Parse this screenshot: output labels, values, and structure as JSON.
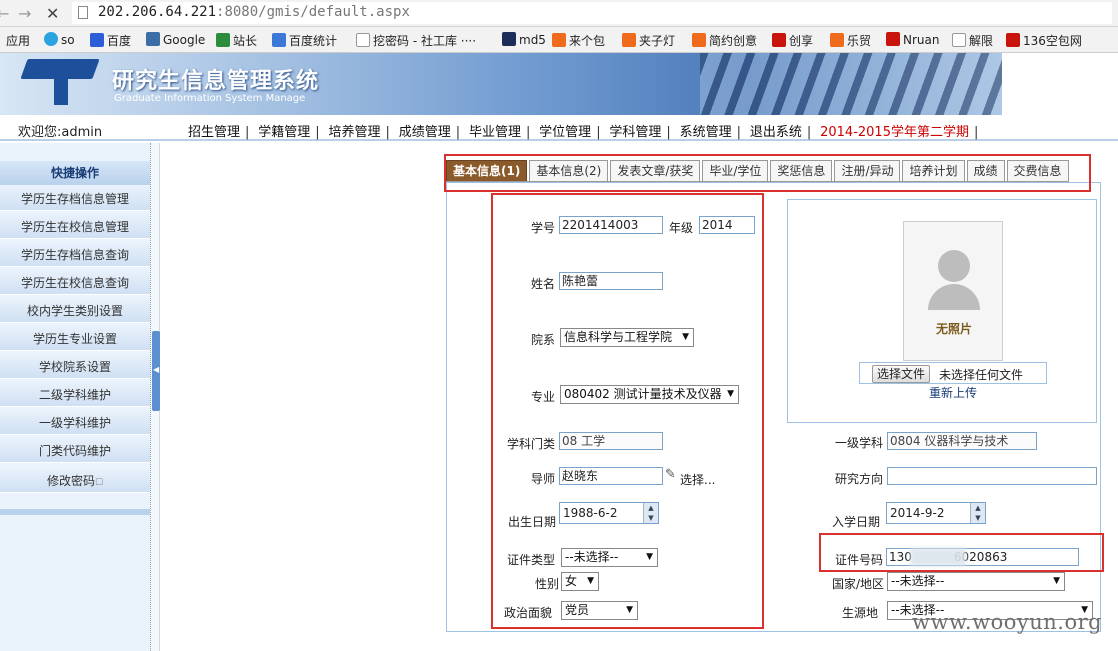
{
  "browser": {
    "url_host": "202.206.64.221",
    "url_rest": ":8080/gmis/default.aspx",
    "bookmarks": [
      "应用",
      "so",
      "百度",
      "Google",
      "站长",
      "百度统计",
      "挖密码 - 社工库 ····",
      "md5",
      "来个包",
      "夹子灯",
      "简约创意",
      "创享",
      "乐贸",
      "Nruan",
      "解限",
      "136空包网"
    ]
  },
  "header": {
    "title": "研究生信息管理系统",
    "subtitle": "Graduate Information System Manage"
  },
  "nav": {
    "welcome": "欢迎您:admin",
    "items": [
      "招生管理",
      "学籍管理",
      "培养管理",
      "成绩管理",
      "毕业管理",
      "学位管理",
      "学科管理",
      "系统管理",
      "退出系统"
    ],
    "term": "2014-2015学年第二学期"
  },
  "sidebar": {
    "header": "快捷操作",
    "items": [
      "学历生存档信息管理",
      "学历生在校信息管理",
      "学历生存档信息查询",
      "学历生在校信息查询",
      "校内学生类别设置",
      "学历生专业设置",
      "学校院系设置",
      "二级学科维护",
      "一级学科维护",
      "门类代码维护"
    ],
    "change_password": "修改密码"
  },
  "tabs": [
    "基本信息(1)",
    "基本信息(2)",
    "发表文章/获奖",
    "毕业/学位",
    "奖惩信息",
    "注册/异动",
    "培养计划",
    "成绩",
    "交费信息"
  ],
  "form": {
    "student_id_label": "学号",
    "student_id": "2201414003",
    "grade_label": "年级",
    "grade": "2014",
    "name_label": "姓名",
    "name": "陈艳蕾",
    "department_label": "院系",
    "department": "信息科学与工程学院",
    "major_label": "专业",
    "major": "080402 测试计量技术及仪器",
    "discipline_category_label": "学科门类",
    "discipline_category": "08 工学",
    "primary_discipline_label": "一级学科",
    "primary_discipline": "0804 仪器科学与技术",
    "advisor_label": "导师",
    "advisor": "赵晓东",
    "advisor_select": "选择...",
    "research_direction_label": "研究方向",
    "research_direction": "",
    "birth_date_label": "出生日期",
    "birth_date": "1988-6-2",
    "enroll_date_label": "入学日期",
    "enroll_date": "2014-9-2",
    "id_type_label": "证件类型",
    "id_type": "--未选择--",
    "id_number_label": "证件号码",
    "id_number_prefix": "130",
    "id_number_suffix": "6020863",
    "gender_label": "性别",
    "gender": "女",
    "country_label": "国家/地区",
    "country": "--未选择--",
    "political_label": "政治面貌",
    "political": "党员",
    "origin_label": "生源地",
    "origin": "--未选择--"
  },
  "photo": {
    "no_photo": "无照片",
    "choose_file": "选择文件",
    "no_file": "未选择任何文件",
    "reupload": "重新上传"
  },
  "watermark": "www.wooyun.org",
  "colors": {
    "highlight_red": "#d9322e",
    "active_tab": "#8b5a2b",
    "term": "#cc0000"
  }
}
